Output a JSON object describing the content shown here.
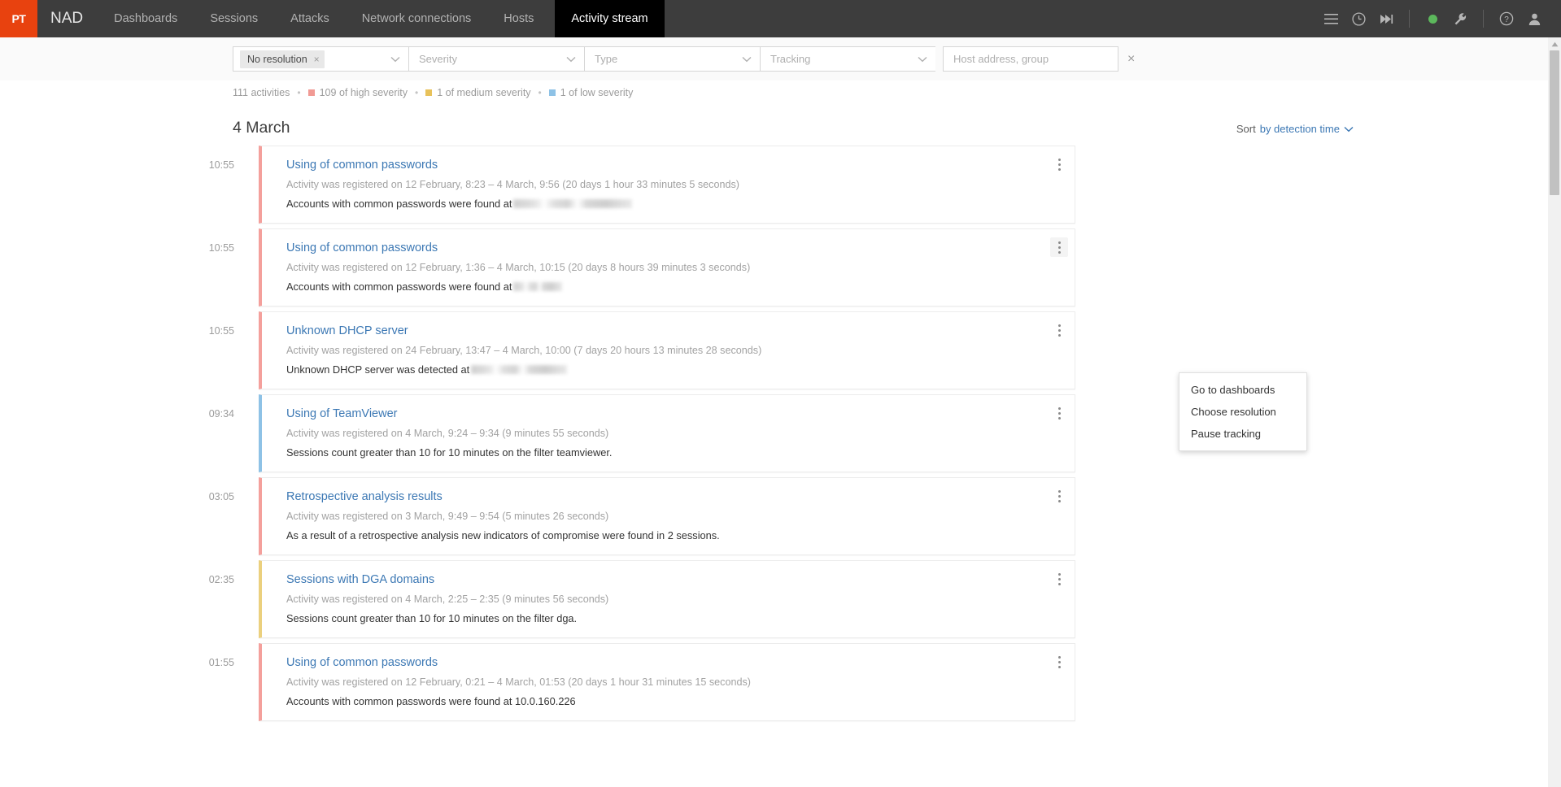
{
  "header": {
    "logo_text": "PT",
    "brand": "NAD",
    "nav": [
      {
        "label": "Dashboards",
        "active": false
      },
      {
        "label": "Sessions",
        "active": false
      },
      {
        "label": "Attacks",
        "active": false
      },
      {
        "label": "Network connections",
        "active": false
      },
      {
        "label": "Hosts",
        "active": false
      },
      {
        "label": "Activity stream",
        "active": true
      }
    ],
    "icons": {
      "menu": "hamburger-menu-icon",
      "clock": "clock-icon",
      "skip": "skip-forward-icon",
      "status": "status-dot-icon",
      "wrench": "wrench-icon",
      "help": "help-circle-icon",
      "user": "user-avatar-icon"
    },
    "status_color": "#5cb85c"
  },
  "filters": {
    "resolution": {
      "chip": "No resolution",
      "remove": "×"
    },
    "severity_placeholder": "Severity",
    "type_placeholder": "Type",
    "tracking_placeholder": "Tracking",
    "host_placeholder": "Host address, group",
    "clear_all": "×"
  },
  "summary": {
    "total": "111 activities",
    "sep": "•",
    "high": {
      "text": "109 of high severity",
      "color": "#f19a94"
    },
    "medium": {
      "text": "1 of medium severity",
      "color": "#e8c25b"
    },
    "low": {
      "text": "1 of low severity",
      "color": "#8ec2e6"
    }
  },
  "main": {
    "date_title": "4 March",
    "sort_label": "Sort",
    "sort_value": "by detection time"
  },
  "context_menu": {
    "items": [
      "Go to dashboards",
      "Choose resolution",
      "Pause tracking"
    ]
  },
  "activities": [
    {
      "time": "10:55",
      "severity": "high",
      "title": "Using of common passwords",
      "meta": "Activity was registered on 12 February, 8:23 – 4 March, 9:56 (20 days 1 hour 33 minutes 5 seconds)",
      "desc_prefix": "Accounts with common passwords were found at",
      "redacted": true,
      "redact_width": 146,
      "menu_open": false
    },
    {
      "time": "10:55",
      "severity": "high",
      "title": "Using of common passwords",
      "meta": "Activity was registered on 12 February, 1:36 – 4 March, 10:15 (20 days 8 hours 39 minutes 3 seconds)",
      "desc_prefix": "Accounts with common passwords were found at",
      "redacted": true,
      "redact_width": 60,
      "menu_open": true
    },
    {
      "time": "10:55",
      "severity": "high",
      "title": "Unknown DHCP server",
      "meta": "Activity was registered on 24 February, 13:47 – 4 March, 10:00 (7 days 20 hours 13 minutes 28 seconds)",
      "desc_prefix": "Unknown DHCP server was detected at",
      "redacted": true,
      "redact_width": 118,
      "menu_open": false
    },
    {
      "time": "09:34",
      "severity": "low",
      "title": "Using of TeamViewer",
      "meta": "Activity was registered on 4 March, 9:24 – 9:34 (9 minutes 55 seconds)",
      "desc_prefix": "Sessions count greater than 10 for 10 minutes on the filter teamviewer.",
      "redacted": false,
      "redact_width": 0,
      "menu_open": false
    },
    {
      "time": "03:05",
      "severity": "high",
      "title": "Retrospective analysis results",
      "meta": "Activity was registered on 3 March, 9:49 – 9:54 (5 minutes 26 seconds)",
      "desc_prefix": "As a result of a retrospective analysis new indicators of compromise were found in 2 sessions.",
      "redacted": false,
      "redact_width": 0,
      "menu_open": false
    },
    {
      "time": "02:35",
      "severity": "medium",
      "title": "Sessions with DGA domains",
      "meta": "Activity was registered on 4 March, 2:25 – 2:35 (9 minutes 56 seconds)",
      "desc_prefix": "Sessions count greater than 10 for 10 minutes on the filter dga.",
      "redacted": false,
      "redact_width": 0,
      "menu_open": false
    },
    {
      "time": "01:55",
      "severity": "high",
      "title": "Using of common passwords",
      "meta": "Activity was registered on 12 February, 0:21 – 4 March, 01:53 (20 days 1 hour 31 minutes 15 seconds)",
      "desc_prefix": "Accounts with common passwords were found at 10.0.160.226",
      "redacted": false,
      "redact_width": 0,
      "menu_open": false
    }
  ]
}
